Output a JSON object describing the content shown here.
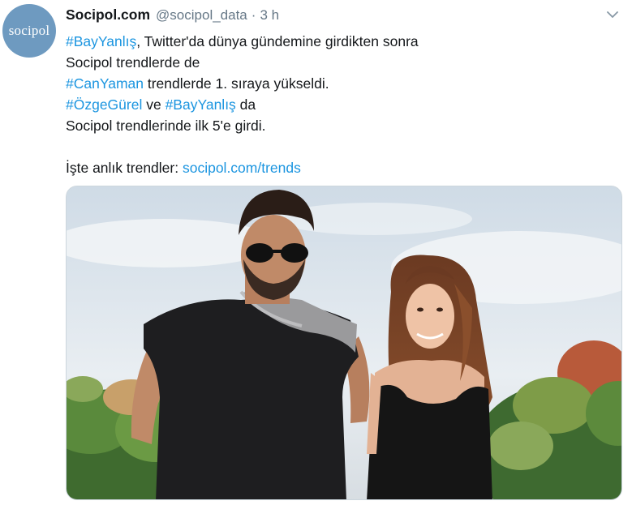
{
  "tweet": {
    "avatar_text": "socipol",
    "display_name": "Socipol.com",
    "handle": "@socipol_data",
    "separator": "·",
    "time": "3 h",
    "lines": [
      {
        "tag": "#BayYanlış",
        "text": ",  Twitter'da dünya gündemine girdikten sonra"
      },
      {
        "text": "Socipol trendlerde de"
      },
      {
        "tag": "#CanYaman",
        "text": " trendlerde 1. sıraya yükseldi."
      },
      {
        "tag": "#ÖzgeGürel",
        "text": " ve ",
        "tag2": "#BayYanlış",
        "text2": " da"
      },
      {
        "text": "Socipol trendlerinde ilk 5'e girdi."
      },
      {
        "text": "İşte anlık trendler: ",
        "link": "socipol.com/trends"
      }
    ]
  },
  "icons": {
    "caret": "chevron-down-icon"
  },
  "colors": {
    "link": "#1b95e0",
    "muted": "#657786",
    "avatar_bg": "#6e9ac0"
  }
}
